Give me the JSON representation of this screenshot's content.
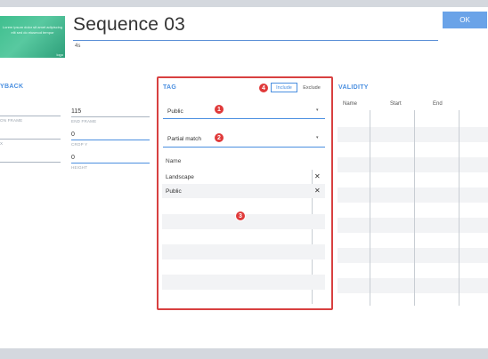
{
  "header": {
    "title": "Sequence 03",
    "duration": "4s",
    "ok_label": "OK",
    "thumbnail_text": "Lorem ipsum dolor sit amet adipiscing elit sed do eiusmod tempor",
    "thumbnail_corner": "logo"
  },
  "playback": {
    "heading": "YBACK",
    "fields": [
      {
        "label": "ON FRAME",
        "value": ""
      },
      {
        "label": "X",
        "value": ""
      },
      {
        "label": "",
        "value": ""
      }
    ],
    "right_fields": [
      {
        "label": "END FRAME",
        "value": "115"
      },
      {
        "label": "CROP Y",
        "value": "0"
      },
      {
        "label": "HEIGHT",
        "value": "0"
      }
    ]
  },
  "tag": {
    "heading": "TAG",
    "mode_options": [
      "Include",
      "Exclude"
    ],
    "active_mode": "Include",
    "select_1": "Public",
    "select_2": "Partial match",
    "list_header": "Name",
    "items": [
      "Landscape",
      "Public"
    ]
  },
  "validity": {
    "heading": "VALIDITY",
    "columns": [
      "Name",
      "Start",
      "End"
    ]
  },
  "badges": [
    "1",
    "2",
    "3",
    "4"
  ],
  "colors": {
    "accent": "#4a8fe0",
    "highlight": "#d84040",
    "badge": "#e03a3a"
  }
}
